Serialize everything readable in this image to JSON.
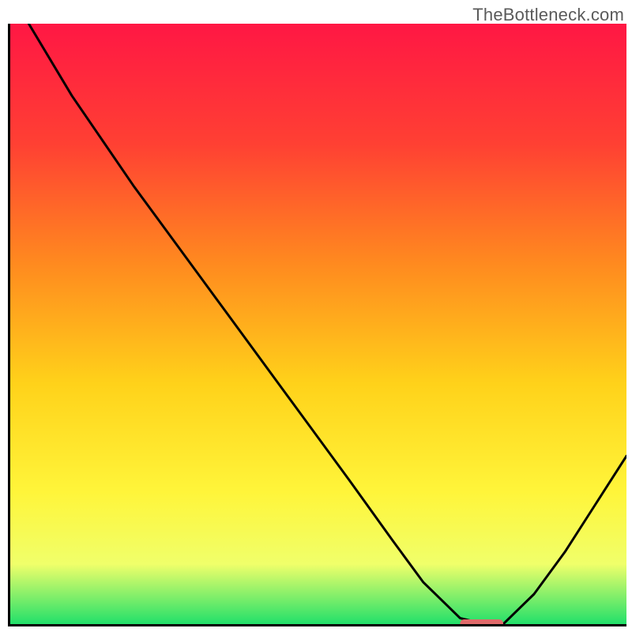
{
  "watermark": "TheBottleneck.com",
  "chart_data": {
    "type": "line",
    "title": "",
    "xlabel": "",
    "ylabel": "",
    "xlim": [
      0,
      100
    ],
    "ylim": [
      0,
      100
    ],
    "background_gradient_stops": [
      {
        "offset": 0,
        "color": "#ff1744"
      },
      {
        "offset": 20,
        "color": "#ff4033"
      },
      {
        "offset": 40,
        "color": "#ff8a1f"
      },
      {
        "offset": 60,
        "color": "#ffd21a"
      },
      {
        "offset": 78,
        "color": "#fff53a"
      },
      {
        "offset": 90,
        "color": "#f0ff6a"
      },
      {
        "offset": 100,
        "color": "#22e06a"
      }
    ],
    "curve": {
      "x": [
        3,
        10,
        20,
        25,
        35,
        45,
        55,
        62,
        67,
        71,
        73,
        77,
        80,
        85,
        90,
        95,
        100
      ],
      "y": [
        100,
        88,
        73,
        66,
        52,
        38,
        24,
        14,
        7,
        3,
        1,
        0,
        0,
        5,
        12,
        20,
        28
      ]
    },
    "marker": {
      "x_start": 73,
      "x_end": 80,
      "y": 0,
      "color": "#e06a6a"
    }
  }
}
